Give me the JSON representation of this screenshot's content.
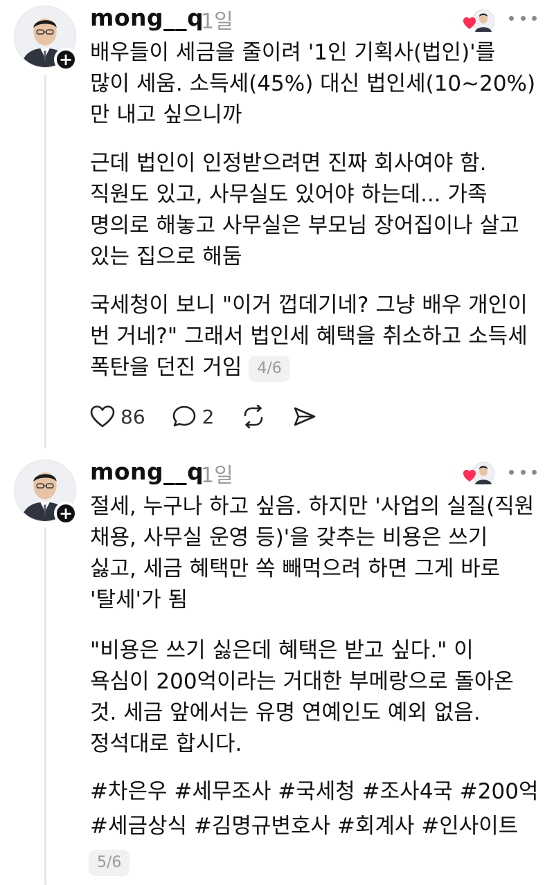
{
  "posts": [
    {
      "username": "mong__q",
      "time": "1일",
      "paragraphs": [
        "배우들이 세금을 줄이려 '1인 기획사(법인)'를 많이 세움. 소득세(45%) 대신 법인세(10~20%)만 내고 싶으니까",
        "근데 법인이 인정받으려면 진짜 회사여야 함. 직원도 있고, 사무실도 있어야 하는데... 가족 명의로 해놓고 사무실은 부모님 장어집이나 살고 있는 집으로 해둠",
        "국세청이 보니 \"이거 껍데기네? 그냥 배우 개인이 번 거네?\" 그래서 법인세 혜택을 취소하고 소득세 폭탄을 던진 거임"
      ],
      "page_indicator": "4/6",
      "likes": "86",
      "comments": "2"
    },
    {
      "username": "mong__q",
      "time": "1일",
      "paragraphs": [
        "절세, 누구나 하고 싶음. 하지만 '사업의 실질(직원 채용, 사무실 운영 등)'을 갖추는 비용은 쓰기 싫고, 세금 혜택만 쏙 빼먹으려 하면 그게 바로 '탈세'가 됨",
        "\"비용은 쓰기 싫은데 혜택은 받고 싶다.\" 이 욕심이 200억이라는 거대한 부메랑으로 돌아온 것. 세금 앞에서는 유명 연예인도 예외 없음. 정석대로 합시다."
      ],
      "hashtags_line1": "#차은우 #세무조사 #국세청 #조사4국 #200억",
      "hashtags_line2": "#세금상식 #김명규변호사 #회계사 #인사이트",
      "page_indicator": "5/6"
    }
  ],
  "icons": {
    "follow": "plus-icon",
    "more": "more-horizontal-icon",
    "like": "heart-icon",
    "comment": "comment-bubble-icon",
    "repost": "repost-icon",
    "share": "send-icon"
  },
  "colors": {
    "heart": "#ff2e55",
    "muted": "#9a9a9a",
    "text": "#111111"
  }
}
